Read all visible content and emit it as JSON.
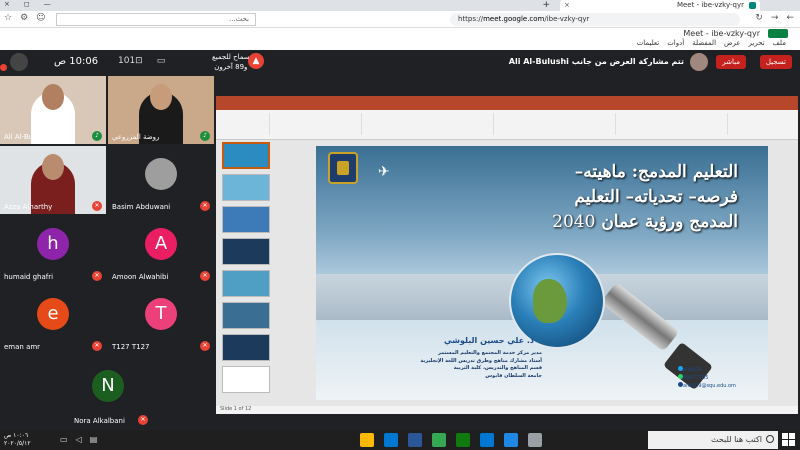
{
  "browser": {
    "tab_title": "Meet - ibe-vzky-qyr",
    "tab_close": "×",
    "new_tab": "+",
    "window_controls": [
      "×",
      "◻",
      "—"
    ],
    "url_scheme": "https://",
    "url_domain": "meet.google.com",
    "url_path": "/ibe-vzky-qyr",
    "search_placeholder": "بحث...",
    "nav": [
      "←",
      "→",
      "↻"
    ],
    "toolbar_icons": [
      "☆",
      "⚙",
      "☺"
    ]
  },
  "meet_menu": {
    "title": "Meet - ibe-vzky-qyr",
    "items": [
      "ملف",
      "تحرير",
      "عرض",
      "المفضلة",
      "أدوات",
      "تعليمات"
    ]
  },
  "meet_bar": {
    "record_label": "تسجيل",
    "live_label": "مباشر",
    "presenting": "تتم مشاركة العرض من جانب Ali Al-Bulushi",
    "allow_line1": "سماح للجميع",
    "allow_line2": "و89 آخرون",
    "clock": "10:06 ص",
    "icons": [
      "◉",
      "▭",
      "101⊡"
    ]
  },
  "participants": [
    {
      "name": "Ali Al-Bulushi",
      "mic": "on",
      "kind": "photo",
      "bg": "#d9c8b8",
      "skin": "#b08060",
      "cloth": "#ffffff"
    },
    {
      "name": "روضة المزروعي",
      "mic": "on",
      "kind": "photo",
      "bg": "#caa88a",
      "skin": "#c79c7a",
      "cloth": "#1a1a1a"
    },
    {
      "name": "Azza Alharthy",
      "mic": "off",
      "kind": "photo",
      "bg": "#dfe3e6",
      "skin": "#b98c70",
      "cloth": "#7a1e1e"
    },
    {
      "name": "Basim Abduwani",
      "mic": "off",
      "kind": "avatar",
      "bg": "#202124"
    },
    {
      "name": "humaid ghafri",
      "mic": "off",
      "kind": "letter",
      "letter": "h",
      "color": "#8e24aa"
    },
    {
      "name": "Amoon Alwahibi",
      "mic": "off",
      "kind": "letter",
      "letter": "A",
      "color": "#e91e63"
    },
    {
      "name": "eman amr",
      "mic": "off",
      "kind": "letter",
      "letter": "e",
      "color": "#e64a19"
    },
    {
      "name": "T127 T127",
      "mic": "off",
      "kind": "letter",
      "letter": "T",
      "color": "#ec407a"
    },
    {
      "name": "Nora Alkalbani",
      "mic": "off",
      "kind": "letter",
      "letter": "N",
      "color": "#1b5e20"
    }
  ],
  "slide": {
    "title_line1": "التعليم المدمج: ماهيته–",
    "title_line2": "فرصه– تحدياته– التعليم",
    "title_line3_text": "المدمج ورؤية عمان",
    "title_line3_num": "2040",
    "author": "د. علي حسين البلوشي",
    "affiliation": [
      "مدير مركز خدمة المجتمع والتعليم المستمر",
      "أستاذ مشارك مناهج وطرق تدريس اللغة الإنجليزية",
      "قسم المناهج والتدريس، كلية التربية",
      "جامعة السلطان قابوس"
    ],
    "contacts": [
      "alia109",
      "99477795",
      "alia109@squ.edu.om"
    ]
  },
  "ppt": {
    "status": "Slide 1 of 12"
  },
  "taskbar": {
    "search_placeholder": "اكتب هنا للبحث",
    "time": "١٠:٠٦ ص",
    "date": "٢٠٢٠/٥/١٢",
    "app_colors": [
      "#ffb900",
      "#0078d4",
      "#2b579a",
      "#34a853",
      "#0f7b0f",
      "#0078d4",
      "#1e88e5",
      "#9aa0a6"
    ]
  }
}
